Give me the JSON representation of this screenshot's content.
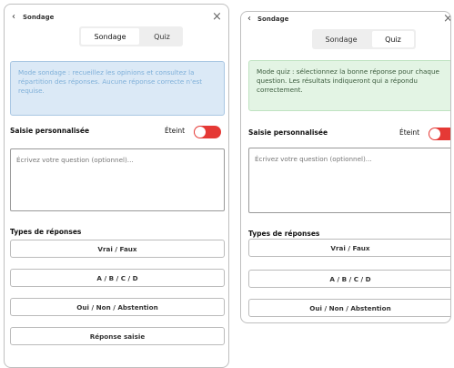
{
  "header": {
    "back_icon": "‹",
    "close_icon": "×",
    "title": "Sondage"
  },
  "tabs": [
    "Sondage",
    "Quiz"
  ],
  "left": {
    "active_tab": "Sondage",
    "info_text": "Mode sondage : recueillez les opinions et consultez la répartition des réponses. Aucune réponse correcte n'est requise.",
    "custom_label": "Saisie personnalisée",
    "toggle_state": "Éteint",
    "question_placeholder": "Écrivez votre question (optionnel)...",
    "types_label": "Types de réponses",
    "answer_types": [
      "Vrai / Faux",
      "A / B / C / D",
      "Oui / Non / Abstention",
      "Réponse saisie"
    ]
  },
  "right": {
    "active_tab": "Quiz",
    "info_text": "Mode quiz : sélectionnez la bonne réponse pour chaque question. Les résultats indiqueront qui a répondu correctement.",
    "custom_label": "Saisie personnalisée",
    "toggle_state": "Éteint",
    "question_placeholder": "Écrivez votre question (optionnel)...",
    "types_label": "Types de réponses",
    "answer_types": [
      "Vrai / Faux",
      "A / B / C / D",
      "Oui / Non / Abstention"
    ]
  }
}
